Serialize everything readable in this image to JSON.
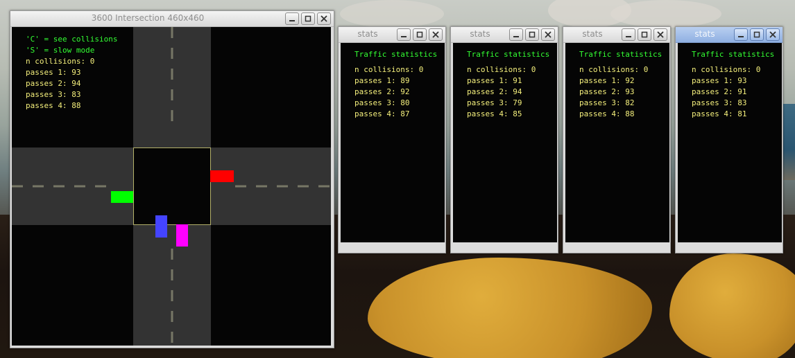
{
  "main_window": {
    "title": "3600 Intersection 460x460",
    "hud": {
      "hint_collisions": "'C' = see collisions",
      "hint_slow": "'S' = slow mode",
      "collisions": "n collisions: 0",
      "passes": [
        "passes 1: 93",
        "passes 2: 94",
        "passes 3: 83",
        "passes 4: 88"
      ]
    },
    "cars": [
      {
        "name": "car-red",
        "color": "#ff0000"
      },
      {
        "name": "car-green",
        "color": "#00ff00"
      },
      {
        "name": "car-blue",
        "color": "#4444ff"
      },
      {
        "name": "car-magenta",
        "color": "#ff00ff"
      }
    ]
  },
  "stats_windows": [
    {
      "title": "stats",
      "heading": "Traffic statistics",
      "collisions": "n collisions: 0",
      "passes": [
        "passes 1: 89",
        "passes 2: 92",
        "passes 3: 80",
        "passes 4: 87"
      ]
    },
    {
      "title": "stats",
      "heading": "Traffic statistics",
      "collisions": "n collisions: 0",
      "passes": [
        "passes 1: 91",
        "passes 2: 94",
        "passes 3: 79",
        "passes 4: 85"
      ]
    },
    {
      "title": "stats",
      "heading": "Traffic statistics",
      "collisions": "n collisions: 0",
      "passes": [
        "passes 1: 92",
        "passes 2: 93",
        "passes 3: 82",
        "passes 4: 88"
      ]
    },
    {
      "title": "stats",
      "heading": "Traffic statistics",
      "collisions": "n collisions: 0",
      "passes": [
        "passes 1: 93",
        "passes 2: 91",
        "passes 3: 83",
        "passes 4: 81"
      ],
      "active": true
    }
  ],
  "window_buttons": {
    "minimize_icon": "minimize-icon",
    "maximize_icon": "maximize-icon",
    "close_icon": "close-icon"
  }
}
